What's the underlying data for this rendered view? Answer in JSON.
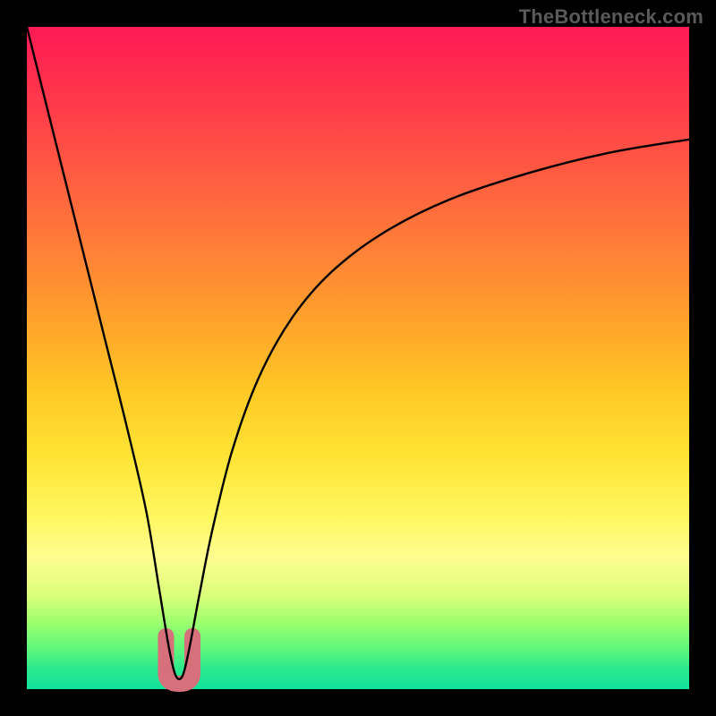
{
  "watermark": "TheBottleneck.com",
  "chart_data": {
    "type": "line",
    "title": "",
    "xlabel": "",
    "ylabel": "",
    "xlim": [
      0,
      100
    ],
    "ylim": [
      0,
      100
    ],
    "series": [
      {
        "name": "curve",
        "x": [
          0,
          3,
          6,
          9,
          12,
          15,
          18,
          20,
          21.5,
          22.5,
          23.5,
          24.5,
          26,
          28,
          31,
          35,
          40,
          46,
          54,
          64,
          76,
          88,
          100
        ],
        "values": [
          100,
          88,
          76,
          64,
          52,
          40,
          27,
          15,
          6,
          2,
          2,
          6,
          14,
          24,
          36,
          47,
          56,
          63,
          69,
          74,
          78,
          81,
          83
        ]
      }
    ],
    "minimum_marker": {
      "x_range": [
        21,
        25
      ],
      "y_range": [
        0,
        8
      ],
      "color": "#d6717b"
    }
  }
}
